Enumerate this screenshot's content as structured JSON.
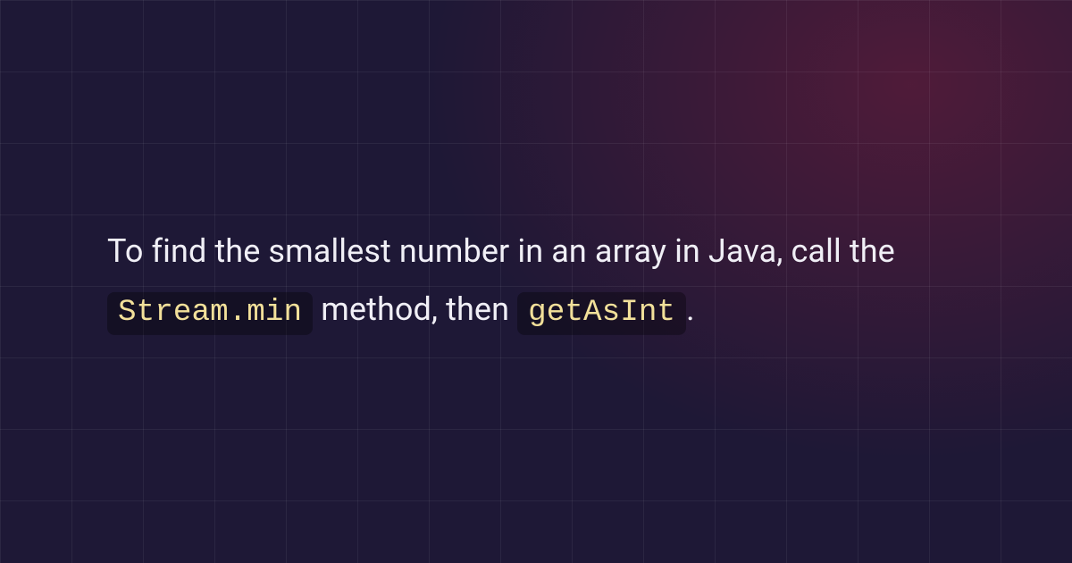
{
  "text": {
    "part1": "To find the smallest number in an array in Java, call the ",
    "code1": "Stream.min",
    "part2": " method, then ",
    "code2": "getAsInt",
    "part3": "."
  }
}
